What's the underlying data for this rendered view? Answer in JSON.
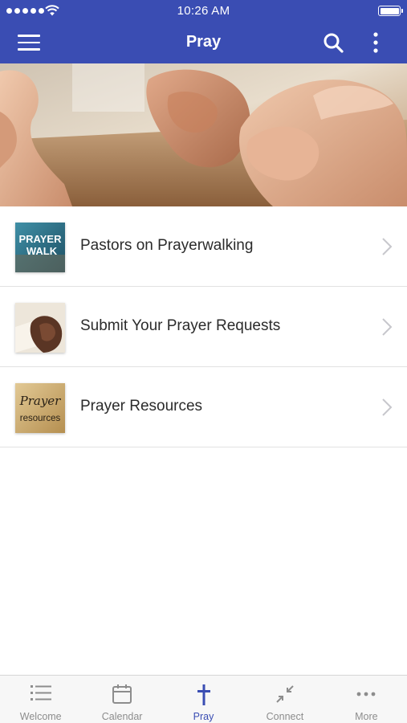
{
  "status_bar": {
    "time": "10:26 AM"
  },
  "header": {
    "title": "Pray"
  },
  "list": {
    "items": [
      {
        "label": "Pastors on Prayerwalking",
        "thumb_text": [
          "PRAYER",
          "WALK"
        ]
      },
      {
        "label": "Submit Your Prayer Requests"
      },
      {
        "label": "Prayer Resources",
        "thumb_text": [
          "Prayer",
          "resources"
        ]
      }
    ]
  },
  "tabs": [
    {
      "label": "Welcome",
      "icon": "list-icon"
    },
    {
      "label": "Calendar",
      "icon": "calendar-icon"
    },
    {
      "label": "Pray",
      "icon": "cross-icon",
      "active": true
    },
    {
      "label": "Connect",
      "icon": "connect-icon"
    },
    {
      "label": "More",
      "icon": "more-dots-icon"
    }
  ],
  "colors": {
    "primary": "#3a4db3",
    "tab_inactive": "#8d8d8d",
    "divider": "#e2e2e2"
  }
}
